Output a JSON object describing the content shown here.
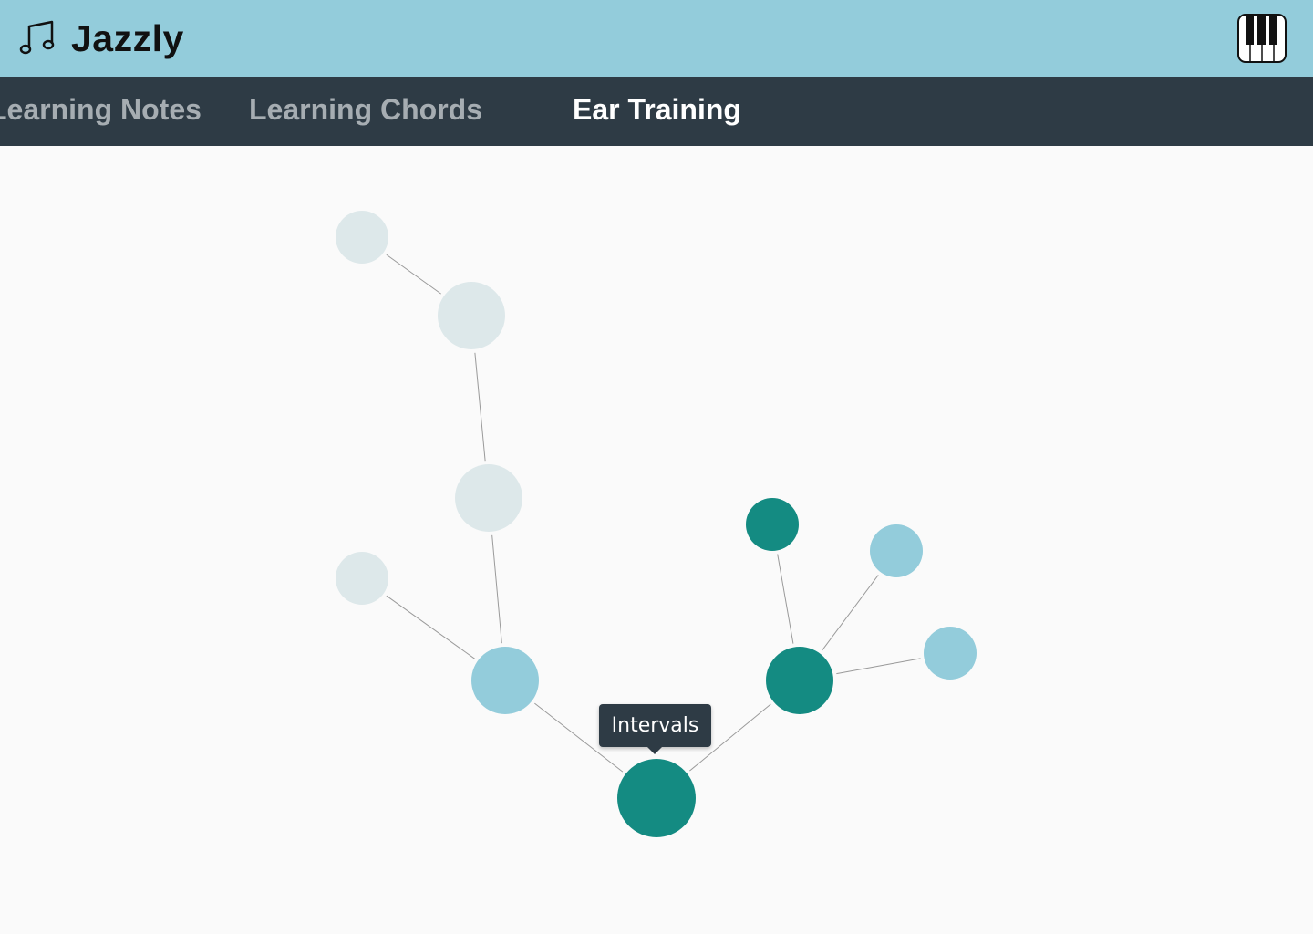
{
  "app": {
    "title": "Jazzly",
    "logo_icon": "music-note-icon",
    "piano_icon": "piano-keys-icon",
    "header_color": "#93ccdb"
  },
  "nav": {
    "background": "#2e3b45",
    "tabs": [
      {
        "label": "Learning Notes",
        "active": false
      },
      {
        "label": "Learning Chords",
        "active": false
      },
      {
        "label": "Ear Training",
        "active": true
      }
    ]
  },
  "skill_tree": {
    "status_colors": {
      "locked": "#dde8ea",
      "available": "#93ccdb",
      "completed": "#148b82"
    },
    "nodes": [
      {
        "id": "root",
        "status": "completed",
        "size": "large"
      },
      {
        "id": "left-branch",
        "status": "available",
        "size": "medium"
      },
      {
        "id": "left-leaf",
        "status": "locked",
        "size": "small"
      },
      {
        "id": "left-mid",
        "status": "locked",
        "size": "medium"
      },
      {
        "id": "left-upper",
        "status": "locked",
        "size": "medium"
      },
      {
        "id": "left-top",
        "status": "locked",
        "size": "small"
      },
      {
        "id": "right-branch",
        "status": "completed",
        "size": "medium"
      },
      {
        "id": "right-top",
        "status": "completed",
        "size": "small"
      },
      {
        "id": "right-upper",
        "status": "available",
        "size": "small"
      },
      {
        "id": "right-side",
        "status": "available",
        "size": "small"
      }
    ],
    "edges": [
      [
        "root",
        "left-branch"
      ],
      [
        "root",
        "right-branch"
      ],
      [
        "left-branch",
        "left-leaf"
      ],
      [
        "left-branch",
        "left-mid"
      ],
      [
        "left-mid",
        "left-upper"
      ],
      [
        "left-upper",
        "left-top"
      ],
      [
        "right-branch",
        "right-top"
      ],
      [
        "right-branch",
        "right-upper"
      ],
      [
        "right-branch",
        "right-side"
      ]
    ],
    "tooltip": {
      "node": "root",
      "text": "Intervals"
    }
  }
}
